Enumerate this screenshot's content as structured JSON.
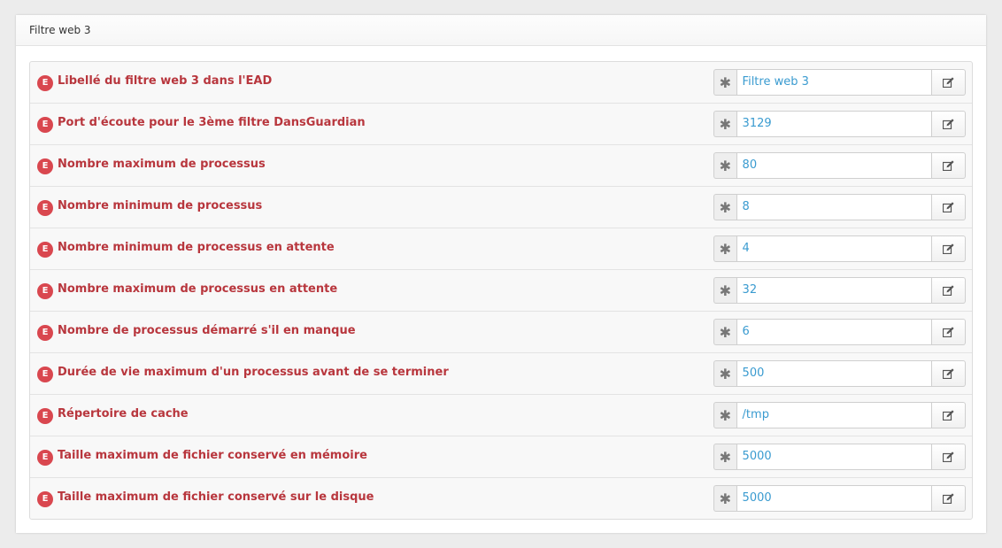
{
  "panel": {
    "title": "Filtre web 3"
  },
  "badge_letter": "E",
  "required_glyph": "✱",
  "colors": {
    "label": "#b8363d",
    "badge": "#d9474f",
    "value": "#3a9bd0"
  },
  "rows": [
    {
      "label": "Libellé du filtre web 3 dans l'EAD",
      "value": "Filtre web 3"
    },
    {
      "label": "Port d'écoute pour le 3ème filtre DansGuardian",
      "value": "3129"
    },
    {
      "label": "Nombre maximum de processus",
      "value": "80"
    },
    {
      "label": "Nombre minimum de processus",
      "value": "8"
    },
    {
      "label": "Nombre minimum de processus en attente",
      "value": "4"
    },
    {
      "label": "Nombre maximum de processus en attente",
      "value": "32"
    },
    {
      "label": "Nombre de processus démarré s'il en manque",
      "value": "6"
    },
    {
      "label": "Durée de vie maximum d'un processus avant de se terminer",
      "value": "500"
    },
    {
      "label": "Répertoire de cache",
      "value": "/tmp"
    },
    {
      "label": "Taille maximum de fichier conservé en mémoire",
      "value": "5000"
    },
    {
      "label": "Taille maximum de fichier conservé sur le disque",
      "value": "5000"
    }
  ]
}
